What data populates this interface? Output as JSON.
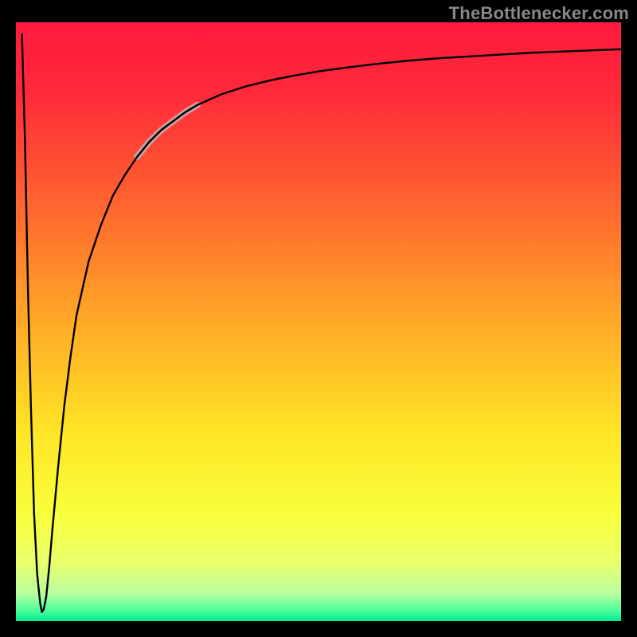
{
  "watermark": "TheBottlenecker.com",
  "chart_data": {
    "type": "line",
    "title": "",
    "xlabel": "",
    "ylabel": "",
    "xlim": [
      0,
      100
    ],
    "ylim": [
      0,
      100
    ],
    "axes_visible": false,
    "grid": false,
    "background": {
      "type": "vertical_gradient",
      "stops": [
        {
          "t": 0.0,
          "color": "#ff1a3e"
        },
        {
          "t": 0.12,
          "color": "#ff2a3a"
        },
        {
          "t": 0.32,
          "color": "#ff6a2e"
        },
        {
          "t": 0.5,
          "color": "#ffa927"
        },
        {
          "t": 0.68,
          "color": "#ffe326"
        },
        {
          "t": 0.82,
          "color": "#f8ff3a"
        },
        {
          "t": 0.9,
          "color": "#eaff6a"
        },
        {
          "t": 0.955,
          "color": "#b8ffa0"
        },
        {
          "t": 0.985,
          "color": "#40ff9a"
        },
        {
          "t": 1.0,
          "color": "#00e792"
        }
      ]
    },
    "series": [
      {
        "name": "bottleneck-curve",
        "color": "#000000",
        "stroke_width": 2.4,
        "highlight_segment": {
          "x_start": 20,
          "x_end": 30,
          "color": "#caa0a0",
          "stroke_width": 8
        },
        "x": [
          1.0,
          1.5,
          2.0,
          2.5,
          3.0,
          3.5,
          4.0,
          4.3,
          4.6,
          5.0,
          5.5,
          6.0,
          7.0,
          8.0,
          9.0,
          10,
          12,
          14,
          16,
          18,
          20,
          22,
          24,
          26,
          28,
          30,
          34,
          38,
          42,
          46,
          50,
          55,
          60,
          65,
          70,
          75,
          80,
          85,
          90,
          95,
          100
        ],
        "y": [
          98,
          80,
          55,
          35,
          18,
          8,
          3,
          1.5,
          2.0,
          4.0,
          9.0,
          15,
          26,
          36,
          44,
          51,
          60,
          66,
          71,
          74.5,
          77.5,
          80,
          82,
          83.5,
          85,
          86.2,
          88,
          89.3,
          90.3,
          91.1,
          91.8,
          92.5,
          93.1,
          93.6,
          94.0,
          94.3,
          94.6,
          94.9,
          95.1,
          95.3,
          95.5
        ]
      }
    ]
  }
}
